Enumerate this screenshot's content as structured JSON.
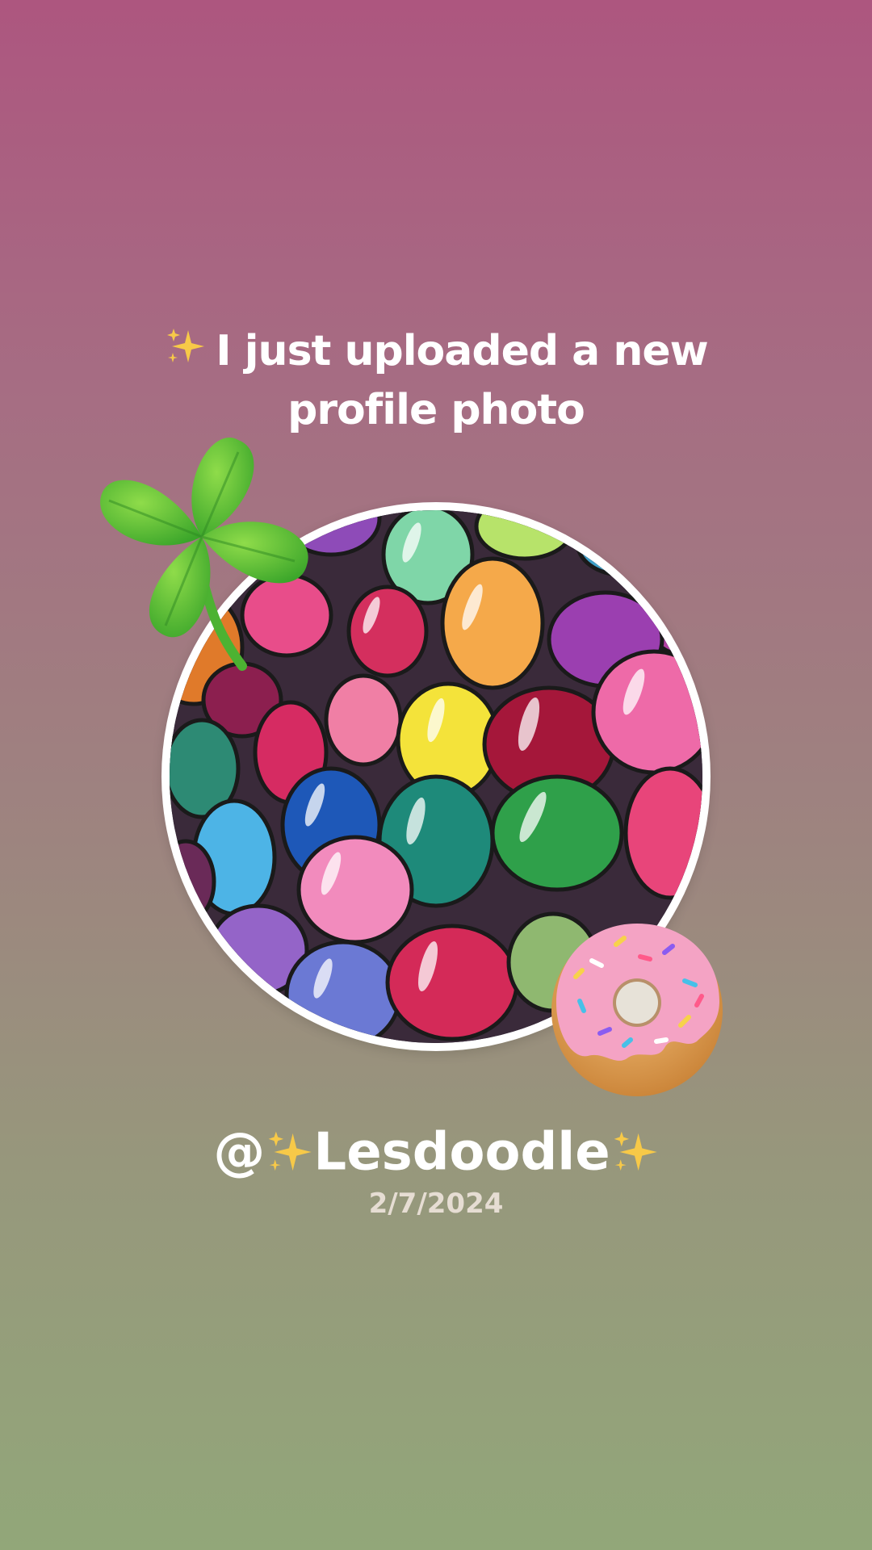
{
  "headline": {
    "line1": "I just uploaded a new",
    "line2": "profile photo"
  },
  "profile": {
    "at_symbol": "@",
    "username": "Lesdoodle",
    "date": "2/7/2024"
  },
  "icons": {
    "sparkle": "sparkles-icon",
    "clover": "four-leaf-clover-icon",
    "donut": "donut-icon"
  },
  "colors": {
    "background_top": "#ad567f",
    "background_bottom": "#92a779",
    "text": "#ffffff",
    "date_text": "#e6ddd3",
    "sparkle": "#f7c948",
    "clover": "#5cc33a",
    "donut_icing": "#f4a3c4"
  }
}
